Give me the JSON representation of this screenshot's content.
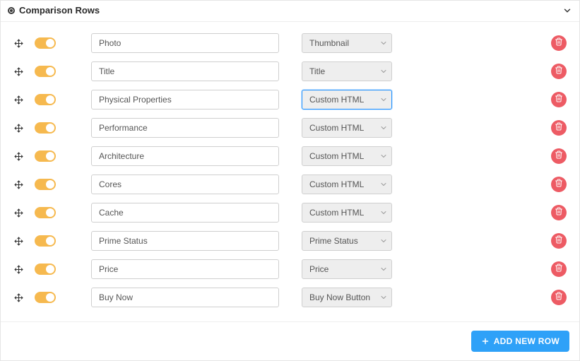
{
  "header": {
    "title": "Comparison Rows"
  },
  "rows": [
    {
      "label": "Photo",
      "type": "Thumbnail",
      "focused": false
    },
    {
      "label": "Title",
      "type": "Title",
      "focused": false
    },
    {
      "label": "Physical Properties",
      "type": "Custom HTML",
      "focused": true
    },
    {
      "label": "Performance",
      "type": "Custom HTML",
      "focused": false
    },
    {
      "label": "Architecture",
      "type": "Custom HTML",
      "focused": false
    },
    {
      "label": "Cores",
      "type": "Custom HTML",
      "focused": false
    },
    {
      "label": "Cache",
      "type": "Custom HTML",
      "focused": false
    },
    {
      "label": "Prime Status",
      "type": "Prime Status",
      "focused": false
    },
    {
      "label": "Price",
      "type": "Price",
      "focused": false
    },
    {
      "label": "Buy Now",
      "type": "Buy Now Button",
      "focused": false
    }
  ],
  "footer": {
    "add_label": "ADD NEW ROW"
  }
}
